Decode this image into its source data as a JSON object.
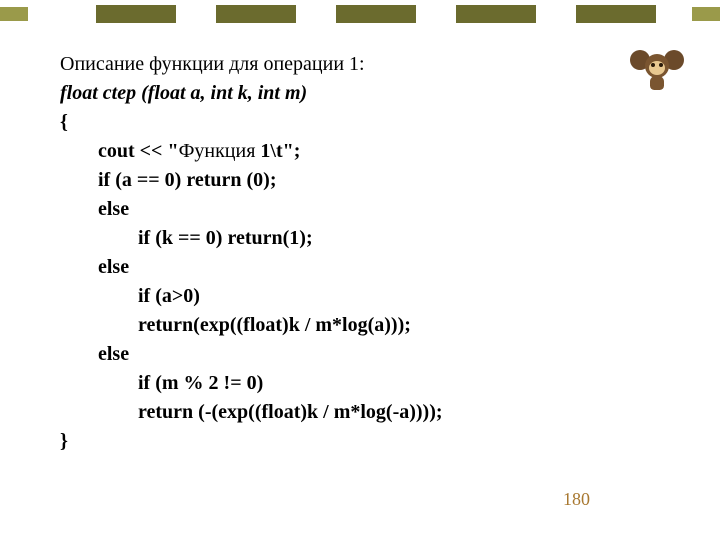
{
  "heading": "Описание функции для операции 1:",
  "signature": "float  ctep (float  a, int  k, int  m)",
  "code": {
    "l1": "{",
    "l2a": "cout << \"",
    "l2b": "Функция",
    "l2c": " 1\\t\";",
    "l3": "if (a == 0)        return (0);",
    "l4": "else",
    "l5": "if (k == 0)\treturn(1);",
    "l6": "else",
    "l7": "if (a>0)",
    "l8": "return(exp((float)k / m*log(a)));",
    "l9": "else",
    "l10": "if (m % 2 != 0)",
    "l11": "return (-(exp((float)k / m*log(-a))));",
    "l12": "}"
  },
  "page_number": "180",
  "mascot_name": "cheburashka-icon"
}
